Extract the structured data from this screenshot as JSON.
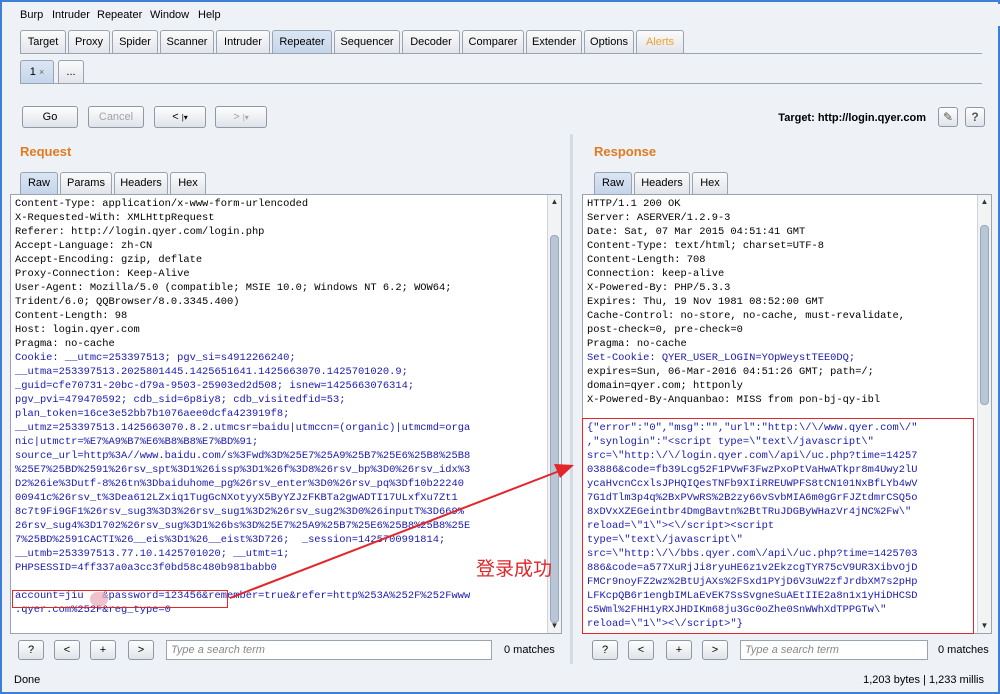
{
  "menu": [
    "Burp",
    "Intruder",
    "Repeater",
    "Window",
    "Help"
  ],
  "tabs": [
    "Target",
    "Proxy",
    "Spider",
    "Scanner",
    "Intruder",
    "Repeater",
    "Sequencer",
    "Decoder",
    "Comparer",
    "Extender",
    "Options",
    "Alerts"
  ],
  "active_tab": "Repeater",
  "subtabs": [
    "1",
    "..."
  ],
  "toolbar": {
    "go": "Go",
    "cancel": "Cancel",
    "back": "<",
    "forward": ">",
    "target_label": "Target: http://login.qyer.com"
  },
  "request": {
    "title": "Request",
    "tabs": [
      "Raw",
      "Params",
      "Headers",
      "Hex"
    ],
    "lines": [
      "Content-Type: application/x-www-form-urlencoded",
      "X-Requested-With: XMLHttpRequest",
      "Referer: http://login.qyer.com/login.php",
      "Accept-Language: zh-CN",
      "Accept-Encoding: gzip, deflate",
      "Proxy-Connection: Keep-Alive",
      "User-Agent: Mozilla/5.0 (compatible; MSIE 10.0; Windows NT 6.2; WOW64;",
      "Trident/6.0; QQBrowser/8.0.3345.400)",
      "Content-Length: 98",
      "Host: login.qyer.com",
      "Pragma: no-cache",
      "Cookie: __utmc=253397513; pgv_si=s4912266240;",
      "__utma=253397513.2025801445.1425651641.1425663070.1425701020.9;",
      "_guid=cfe70731-20bc-d79a-9503-25903ed2d508; isnew=1425663076314;",
      "pgv_pvi=479470592; cdb_sid=6p8iy8; cdb_visitedfid=53;",
      "plan_token=16ce3e52bb7b1076aee0dcfa423919f8;",
      "__utmz=253397513.1425663070.8.2.utmcsr=baidu|utmccn=(organic)|utmcmd=orga",
      "nic|utmctr=%E7%A9%B7%E6%B8%B8%E7%BD%91;",
      "source_url=http%3A//www.baidu.com/s%3Fwd%3D%25E7%25A9%25B7%25E6%25B8%25B8",
      "%25E7%25BD%2591%26rsv_spt%3D1%26issp%3D1%26f%3D8%26rsv_bp%3D0%26rsv_idx%3",
      "D2%26ie%3Dutf-8%26tn%3Dbaiduhome_pg%26rsv_enter%3D0%26rsv_pq%3Df10b22240",
      "00941c%26rsv_t%3Dea612LZxiq1TugGcNXotyyX5ByYZJzFKBTa2gwADTI17ULxfXu7Zt1",
      "8c7t9Fi9GF1%26rsv_sug3%3D3%26rsv_sug1%3D2%26rsv_sug2%3D0%26inputT%3D669%",
      "26rsv_sug4%3D1702%26rsv_sug%3D1%26bs%3D%25E7%25A9%25B7%25E6%25B8%25B8%25E",
      "7%25BD%2591CACTI%26__eis%3D1%26__eist%3D726;  _session=1425700991814;",
      "__utmb=253397513.77.10.1425701020; __utmt=1;",
      "PHPSESSID=4ff337a0a3cc3f0bd58c480b981babb0",
      "",
      "account=jiu   &password=123456&remember=true&refer=http%253A%252F%252Fwww",
      ".qyer.com%252F&reg_type=0"
    ]
  },
  "response": {
    "title": "Response",
    "tabs": [
      "Raw",
      "Headers",
      "Hex"
    ],
    "lines": [
      "HTTP/1.1 200 OK",
      "Server: ASERVER/1.2.9-3",
      "Date: Sat, 07 Mar 2015 04:51:41 GMT",
      "Content-Type: text/html; charset=UTF-8",
      "Content-Length: 708",
      "Connection: keep-alive",
      "X-Powered-By: PHP/5.3.3",
      "Expires: Thu, 19 Nov 1981 08:52:00 GMT",
      "Cache-Control: no-store, no-cache, must-revalidate,",
      "post-check=0, pre-check=0",
      "Pragma: no-cache",
      "Set-Cookie: QYER_USER_LOGIN=YOpWeystTEE0DQ;",
      "expires=Sun, 06-Mar-2016 04:51:26 GMT; path=/;",
      "domain=qyer.com; httponly",
      "X-Powered-By-Anquanbao: MISS from pon-bj-qy-ibl",
      "",
      "{\"error\":\"0\",\"msg\":\"\",\"url\":\"http:\\/\\/www.qyer.com\\/\"",
      ",\"synlogin\":\"<script type=\\\"text\\/javascript\\\"",
      "src=\\\"http:\\/\\/login.qyer.com\\/api\\/uc.php?time=14257",
      "03886&code=fb39Lcg52F1PVwF3FwzPxoPtVaHwATkpr8m4Uwy2lU",
      "ycaHvcnCcxlsJPHQIQesTNFb9XIiRREUWPFS8tCN101NxBfLYb4wV",
      "7G1dTlm3p4q%2BxPVwRS%2B2zy66vSvbMIA6m0gGrFJZtdmrCSQ5o",
      "8xDVxXZEGeintbr4DmgBavtn%2BtTRuJDGByWHazVr4jNC%2Fw\\\"",
      "reload=\\\"1\\\"><\\/script><script",
      "type=\\\"text\\/javascript\\\"",
      "src=\\\"http:\\/\\/bbs.qyer.com\\/api\\/uc.php?time=1425703",
      "886&code=a577XuRjJi8ryuHE6z1v2EkzcgTYR75cV9UR3XibvOjD",
      "FMCr9noyFZ2wz%2BtUjAXs%2FSxd1PYjD6V3uW2zfJrdbXM7s2pHp",
      "LFKcpQB6r1engbIMLaEvEK7SsSvgneSuAEtIIE2a8n1x1yHiDHCSD",
      "c5Wml%2FHH1yRXJHDIKm68ju3Gc0oZhe0SnWWhXdTPPGTw\\\"",
      "reload=\\\"1\\\"><\\/script>\"}"
    ]
  },
  "search": {
    "placeholder": "Type a search term",
    "matches": "0 matches",
    "help": "?",
    "prev": "<",
    "add": "+",
    "next": ">"
  },
  "status": {
    "left": "Done",
    "right": "1,203 bytes | 1,233 millis"
  },
  "annotation": "登录成功",
  "colors": {
    "accent": "#e07b22",
    "highlight": "#e2262a",
    "window_border": "#3d7fd6"
  }
}
